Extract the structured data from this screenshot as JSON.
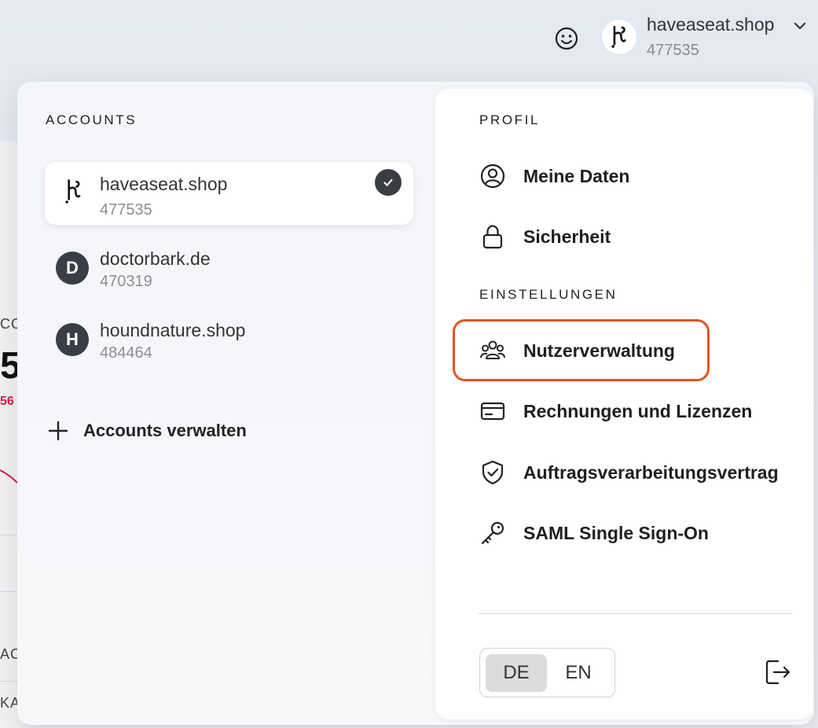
{
  "header": {
    "account_name": "haveaseat.shop",
    "account_id": "477535"
  },
  "background": {
    "text_a": "CO",
    "big_digit": "5",
    "red_value": "56",
    "text_b": "AC",
    "text_c": "KA"
  },
  "accounts": {
    "heading": "ACCOUNTS",
    "items": [
      {
        "name": "haveaseat.shop",
        "id": "477535",
        "selected": true
      },
      {
        "name": "doctorbark.de",
        "id": "470319",
        "initial": "D"
      },
      {
        "name": "houndnature.shop",
        "id": "484464",
        "initial": "H"
      }
    ],
    "manage_label": "Accounts verwalten"
  },
  "profile": {
    "heading": "PROFIL",
    "items": [
      {
        "label": "Meine Daten",
        "icon": "user-circle-icon"
      },
      {
        "label": "Sicherheit",
        "icon": "lock-icon"
      }
    ]
  },
  "settings": {
    "heading": "EINSTELLUNGEN",
    "items": [
      {
        "label": "Nutzerverwaltung",
        "icon": "users-icon"
      },
      {
        "label": "Rechnungen und Lizenzen",
        "icon": "credit-card-icon"
      },
      {
        "label": "Auftragsverarbeitungsvertrag",
        "icon": "shield-check-icon"
      },
      {
        "label": "SAML Single Sign-On",
        "icon": "key-icon"
      }
    ]
  },
  "language": {
    "options": [
      "DE",
      "EN"
    ],
    "selected": "DE"
  },
  "colors": {
    "highlight": "#e2541f",
    "dark": "#3a3d44",
    "red": "#d7194b"
  }
}
